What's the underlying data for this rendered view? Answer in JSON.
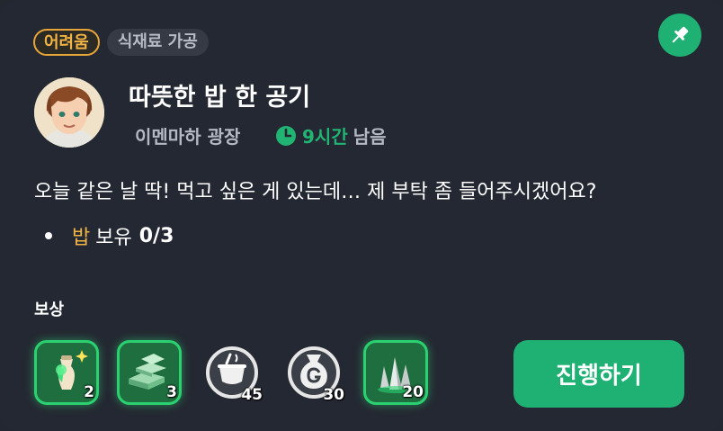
{
  "badges": {
    "difficulty": "어려움",
    "category": "식재료 가공"
  },
  "quest": {
    "title": "따뜻한 밥 한 공기",
    "location": "이멘마하 광장",
    "time_value": "9시간",
    "time_suffix": "남음",
    "description": "오늘 같은 날 딱! 먹고 싶은 게 있는데… 제 부탁 좀 들어주시겠어요?",
    "requirement": {
      "item": "밥",
      "text": "보유",
      "count": "0/3"
    }
  },
  "rewards_label": "보상",
  "rewards": [
    {
      "icon": "potion-vial-icon",
      "qty": "2"
    },
    {
      "icon": "green-ore-stack-icon",
      "qty": "3"
    },
    {
      "icon": "cooking-pot-icon",
      "qty": "45"
    },
    {
      "icon": "gold-pouch-icon",
      "qty": "30"
    },
    {
      "icon": "green-crystal-cluster-icon",
      "qty": "20"
    }
  ],
  "action_label": "진행하기",
  "colors": {
    "accent": "#1fb074",
    "difficulty": "#f2b445",
    "background": "#242832"
  }
}
